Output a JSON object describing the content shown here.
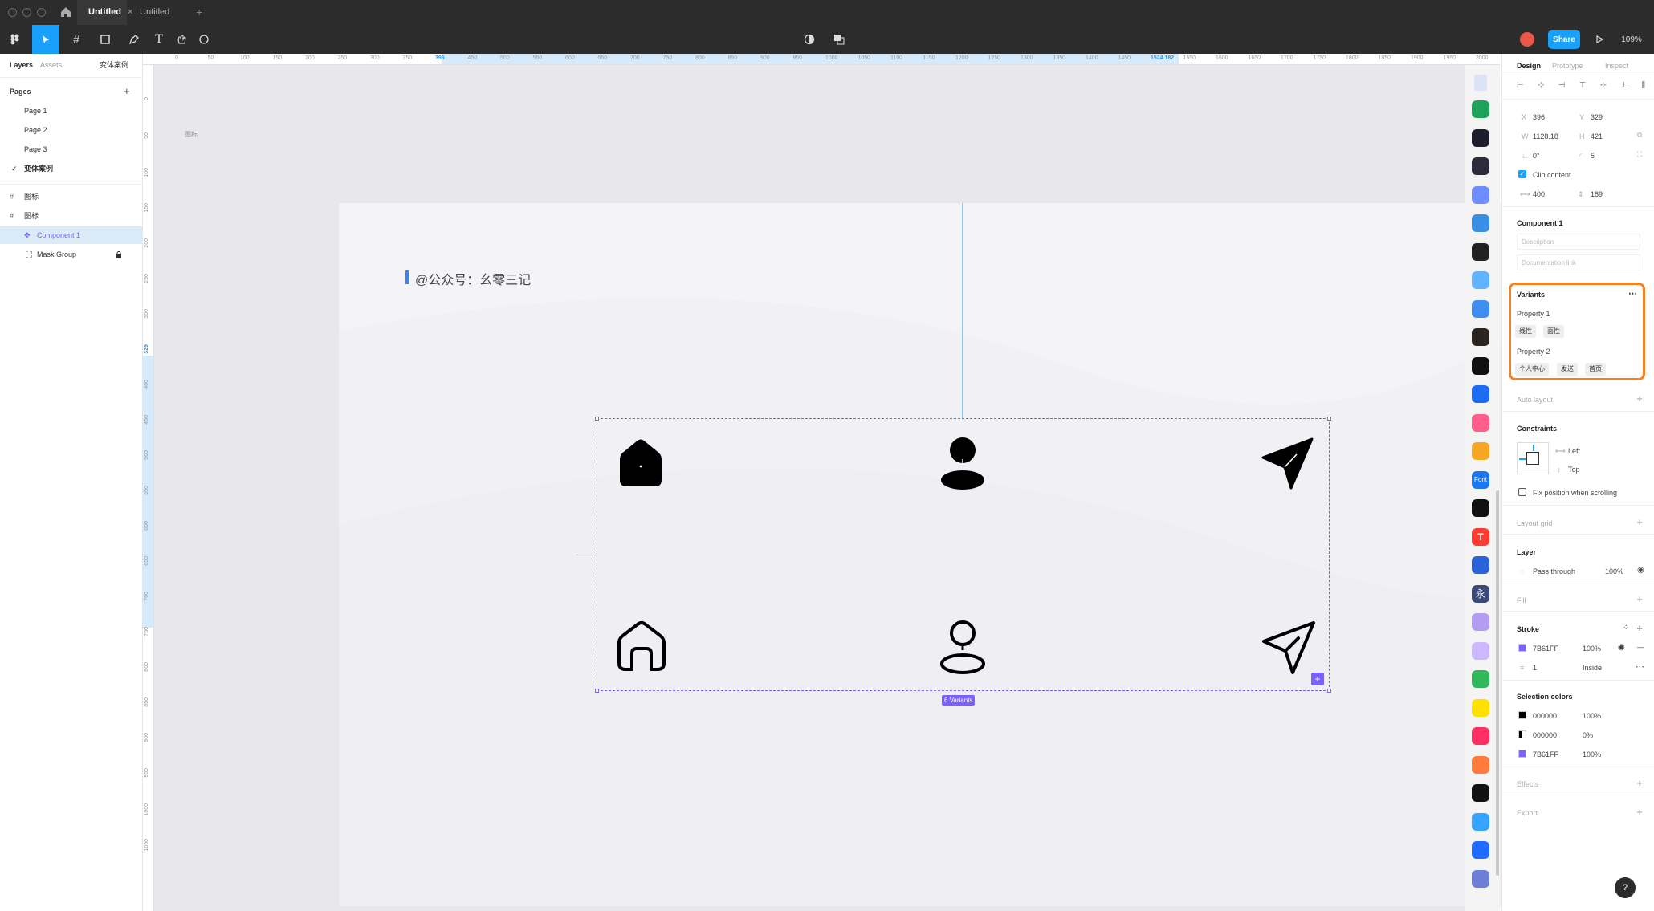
{
  "titlebar": {
    "tabs": [
      {
        "label": "Untitled",
        "active": true
      },
      {
        "label": "Untitled",
        "active": false
      }
    ],
    "new_tab_label": "+"
  },
  "toolbar": {
    "share_label": "Share",
    "zoom_label": "109%"
  },
  "left_panel": {
    "tabs": {
      "layers": "Layers",
      "assets": "Assets",
      "current_page": "变体案例"
    },
    "pages_title": "Pages",
    "pages": [
      "Page 1",
      "Page 2",
      "Page 3",
      "变体案例"
    ],
    "layers": [
      {
        "label": "图标",
        "kind": "frame"
      },
      {
        "label": "图标",
        "kind": "frame"
      },
      {
        "label": "Component 1",
        "kind": "component-set",
        "selected": true
      },
      {
        "label": "Mask Group",
        "kind": "mask",
        "locked": true
      }
    ]
  },
  "rulers": {
    "top": [
      "0",
      "50",
      "100",
      "150",
      "200",
      "250",
      "300",
      "350",
      "396",
      "450",
      "500",
      "550",
      "600",
      "650",
      "700",
      "750",
      "800",
      "850",
      "900",
      "950",
      "1000",
      "1050",
      "1100",
      "1150",
      "1200",
      "1250",
      "1300",
      "1350",
      "1400",
      "1450",
      "1524.182",
      "1550",
      "1600",
      "1650",
      "1700",
      "1750",
      "1800",
      "1850",
      "1900",
      "1950",
      "2000"
    ],
    "left": [
      "0",
      "50",
      "100",
      "150",
      "200",
      "250",
      "300",
      "329",
      "400",
      "450",
      "500",
      "550",
      "600",
      "650",
      "700",
      "750",
      "800",
      "850",
      "900",
      "950",
      "1000",
      "1050"
    ]
  },
  "canvas": {
    "frame_label": "图标",
    "heading": "@公众号：幺零三记",
    "variants_badge": "6 Variants",
    "accent": "#7B61FF",
    "heading_bar_color": "#3b82f6"
  },
  "right_panel": {
    "tabs": {
      "design": "Design",
      "prototype": "Prototype",
      "inspect": "Inspect"
    },
    "x_label": "X",
    "x": "396",
    "y_label": "Y",
    "y": "329",
    "w_label": "W",
    "w": "1128.18",
    "h_label": "H",
    "h": "421",
    "rotation": "0°",
    "radius": "5",
    "clip_content": "Clip content",
    "spacing_h": "400",
    "spacing_v": "189",
    "component_title": "Component 1",
    "description_placeholder": "Description",
    "doc_link_placeholder": "Documentation link",
    "variants_title": "Variants",
    "property1": "Property 1",
    "property1_values": [
      "线性",
      "面性"
    ],
    "property2": "Property 2",
    "property2_values": [
      "个人中心",
      "发送",
      "首页"
    ],
    "auto_layout": "Auto layout",
    "constraints": "Constraints",
    "constraint_h": "Left",
    "constraint_v": "Top",
    "fix_position": "Fix position when scrolling",
    "layout_grid": "Layout grid",
    "layer": "Layer",
    "blend": "Pass through",
    "layer_opacity": "100%",
    "fill": "Fill",
    "stroke": "Stroke",
    "stroke_hex": "7B61FF",
    "stroke_opacity": "100%",
    "stroke_weight": "1",
    "stroke_align": "Inside",
    "selection_colors": "Selection colors",
    "sel_colors": [
      {
        "hex": "000000",
        "opacity": "100%",
        "color": "#000000"
      },
      {
        "hex": "000000",
        "opacity": "0%",
        "color": "#ffffff"
      },
      {
        "hex": "7B61FF",
        "opacity": "100%",
        "color": "#7B61FF"
      }
    ],
    "effects": "Effects",
    "export": "Export",
    "help": "?"
  },
  "plugin_icons": [
    "refresh-plugin-icon",
    "compass-plugin-icon",
    "palette-plugin-icon",
    "pen-plugin-icon",
    "cat-plugin-icon",
    "gear-plugin-icon",
    "stack-plugin-icon",
    "drop-plugin-icon",
    "dark-square-plugin-icon",
    "wave-plugin-icon",
    "cycle-plugin-icon",
    "game-plugin-icon",
    "box-plugin-icon",
    "font-plugin-icon",
    "circle-plugin-icon",
    "t-plugin-icon",
    "lines-plugin-icon",
    "char-plugin-icon",
    "feather-plugin-icon",
    "measure-plugin-icon",
    "green-plugin-icon",
    "arrow-plugin-icon",
    "red-plugin-icon",
    "person-plugin-icon",
    "dark-plugin-icon",
    "frame-plugin-icon",
    "blue-pen-plugin-icon",
    "layers-plugin-icon"
  ],
  "plugin_labels": {
    "font": "Font",
    "t": "T",
    "char": "永"
  }
}
